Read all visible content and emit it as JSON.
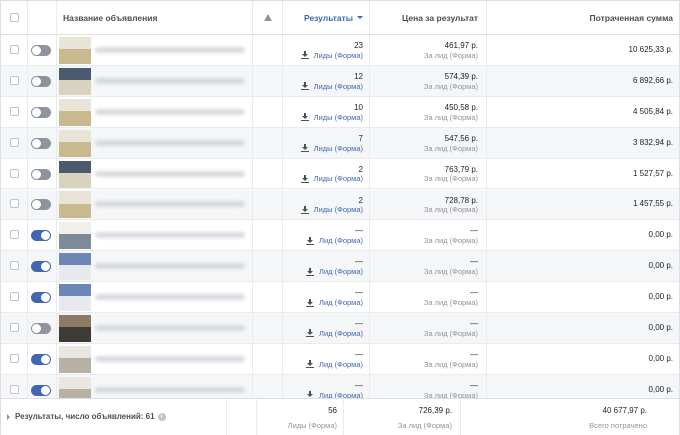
{
  "header": {
    "name": "Название объявления",
    "results": "Результаты",
    "cost_per_result": "Цена за результат",
    "amount_spent": "Потраченная сумма"
  },
  "rows": [
    {
      "toggle": "off",
      "thumb": "t1",
      "result": "23",
      "result_type": "Лиды (Форма)",
      "cost": "461,97 р.",
      "cost_type": "За лид (Форма)",
      "spent": "10 625,33 р."
    },
    {
      "toggle": "off",
      "thumb": "t2",
      "result": "12",
      "result_type": "Лиды (Форма)",
      "cost": "574,39 р.",
      "cost_type": "За лид (Форма)",
      "spent": "6 892,66 р."
    },
    {
      "toggle": "off",
      "thumb": "t1",
      "result": "10",
      "result_type": "Лиды (Форма)",
      "cost": "450,58 р.",
      "cost_type": "За лид (Форма)",
      "spent": "4 505,84 р."
    },
    {
      "toggle": "off",
      "thumb": "t1",
      "result": "7",
      "result_type": "Лиды (Форма)",
      "cost": "547,56 р.",
      "cost_type": "За лид (Форма)",
      "spent": "3 832,94 р."
    },
    {
      "toggle": "off",
      "thumb": "t2",
      "result": "2",
      "result_type": "Лиды (Форма)",
      "cost": "763,79 р.",
      "cost_type": "За лид (Форма)",
      "spent": "1 527,57 р."
    },
    {
      "toggle": "off",
      "thumb": "t1",
      "result": "2",
      "result_type": "Лиды (Форма)",
      "cost": "728,78 р.",
      "cost_type": "За лид (Форма)",
      "spent": "1 457,55 р."
    },
    {
      "toggle": "on",
      "thumb": "t3",
      "result": "—",
      "result_type": "Лид (Форма)",
      "cost": "—",
      "cost_type": "За лид (Форма)",
      "spent": "0,00 р."
    },
    {
      "toggle": "on",
      "thumb": "t4",
      "result": "—",
      "result_type": "Лид (Форма)",
      "cost": "—",
      "cost_type": "За лид (Форма)",
      "spent": "0,00 р."
    },
    {
      "toggle": "on",
      "thumb": "t4",
      "result": "—",
      "result_type": "Лид (Форма)",
      "cost": "—",
      "cost_type": "За лид (Форма)",
      "spent": "0,00 р."
    },
    {
      "toggle": "off",
      "thumb": "t5",
      "result": "—",
      "result_type": "Лид (Форма)",
      "cost": "—",
      "cost_type": "За лид (Форма)",
      "spent": "0,00 р."
    },
    {
      "toggle": "on",
      "thumb": "t6",
      "result": "—",
      "result_type": "Лид (Форма)",
      "cost": "—",
      "cost_type": "За лид (Форма)",
      "spent": "0,00 р."
    },
    {
      "toggle": "on",
      "thumb": "t6",
      "result": "—",
      "result_type": "Лид (Форма)",
      "cost": "—",
      "cost_type": "За лид (Форма)",
      "spent": "0,00 р."
    }
  ],
  "footer": {
    "label": "Результаты, число объявлений: 61",
    "info_icon": "i",
    "results": "56",
    "results_type": "Лиды (Форма)",
    "cost": "726,39 р.",
    "cost_type": "За лид (Форма)",
    "spent": "40 677,97 р.",
    "spent_type": "Всего потрачено"
  },
  "colors": {
    "accent": "#4267b2",
    "toggle_off": "#8d949e",
    "row_alt": "#f5f6f7",
    "border": "#dddfe2"
  }
}
